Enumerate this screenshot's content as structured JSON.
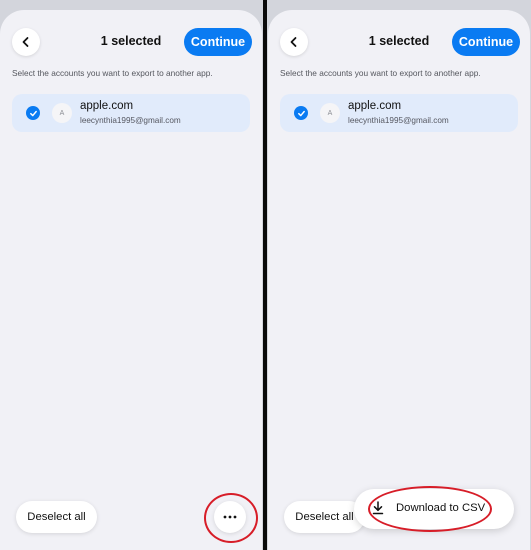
{
  "screens": [
    {
      "header": {
        "back_icon": "chevron-left-icon",
        "title": "1 selected",
        "continue_label": "Continue"
      },
      "instructions": "Select the accounts you want to export to another app.",
      "account": {
        "checked": true,
        "favicon_letter": "A",
        "domain": "apple.com",
        "email": "leecynthia1995@gmail.com"
      },
      "footer": {
        "deselect_label": "Deselect all",
        "more_icon": "ellipsis-icon"
      }
    },
    {
      "header": {
        "back_icon": "chevron-left-icon",
        "title": "1 selected",
        "continue_label": "Continue"
      },
      "instructions": "Select the accounts you want to export to another app.",
      "account": {
        "checked": true,
        "favicon_letter": "A",
        "domain": "apple.com",
        "email": "leecynthia1995@gmail.com"
      },
      "footer": {
        "deselect_label": "Deselect all"
      },
      "menu": {
        "download_icon": "download-icon",
        "download_label": "Download to CSV"
      }
    }
  ],
  "colors": {
    "accent": "#0a7bf2",
    "annotation": "#d71d28",
    "selected_row": "#e1ebfb",
    "sheet_background": "#f1f1f6"
  }
}
